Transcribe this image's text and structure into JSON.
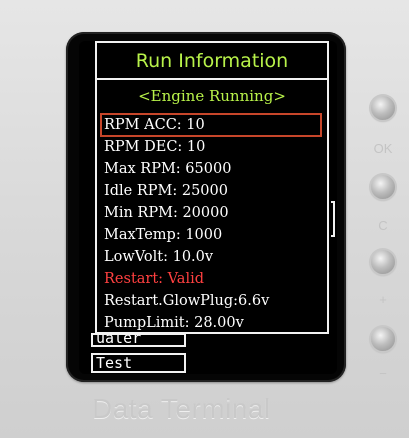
{
  "popup": {
    "title": "Run Information",
    "status": "<Engine Running>",
    "rows": [
      {
        "text": "RPM ACC: 10",
        "selected": true
      },
      {
        "text": "RPM DEC: 10"
      },
      {
        "text": "Max RPM: 65000"
      },
      {
        "text": "Idle RPM: 25000"
      },
      {
        "text": "Min RPM: 20000"
      },
      {
        "text": "MaxTemp: 1000"
      },
      {
        "text": "LowVolt: 10.0v"
      },
      {
        "text": "Restart: Valid",
        "warn": true
      },
      {
        "text": "Restart.GlowPlug:6.6v"
      },
      {
        "text": "PumpLimit: 28.00v"
      }
    ]
  },
  "underlay": {
    "partial_item": "ualer",
    "test_label": "Test"
  },
  "side_buttons": [
    {
      "label": "OK"
    },
    {
      "label": "C"
    },
    {
      "label": "+"
    },
    {
      "label": "−"
    }
  ],
  "brand": "Data Terminal",
  "colors": {
    "title": "#b8f24a",
    "text": "#ffffff",
    "warn": "#ff4040",
    "selection": "#c7462a"
  }
}
